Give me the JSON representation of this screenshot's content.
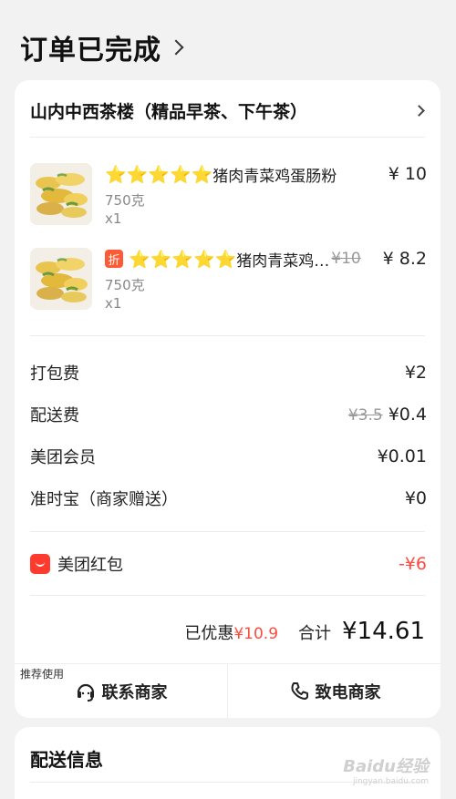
{
  "header": {
    "title": "订单已完成"
  },
  "store": {
    "name": "山内中西茶楼（精品早茶、下午茶）"
  },
  "items": [
    {
      "stars": "⭐⭐⭐⭐⭐",
      "name": "猪肉青菜鸡蛋肠粉",
      "original_price": "",
      "price": "¥ 10",
      "spec": "750克",
      "qty": "x1",
      "badge": ""
    },
    {
      "stars": "⭐⭐⭐⭐⭐",
      "name": "猪肉青菜鸡…",
      "original_price": "¥10",
      "price": "¥ 8.2",
      "spec": "750克",
      "qty": "x1",
      "badge": "折"
    }
  ],
  "fees": [
    {
      "label": "打包费",
      "original": "",
      "value": "¥2"
    },
    {
      "label": "配送费",
      "original": "¥3.5",
      "value": "¥0.4"
    },
    {
      "label": "美团会员",
      "original": "",
      "value": "¥0.01"
    },
    {
      "label": "准时宝（商家赠送）",
      "original": "",
      "value": "¥0"
    }
  ],
  "red_packet": {
    "label": "美团红包",
    "value": "-¥6"
  },
  "summary": {
    "discount_label": "已优惠",
    "discount_value": "¥10.9",
    "total_label": "合计",
    "total_value": "¥14.61"
  },
  "actions": {
    "recommend_tag": "推荐使用",
    "contact": "联系商家",
    "call": "致电商家"
  },
  "delivery": {
    "title": "配送信息"
  },
  "watermark": {
    "text": "Baidu经验",
    "sub": "jingyan.baidu.com"
  },
  "colors": {
    "accent_red": "#ff4a3d",
    "star": "#f5b400",
    "badge": "#ff5a36"
  }
}
